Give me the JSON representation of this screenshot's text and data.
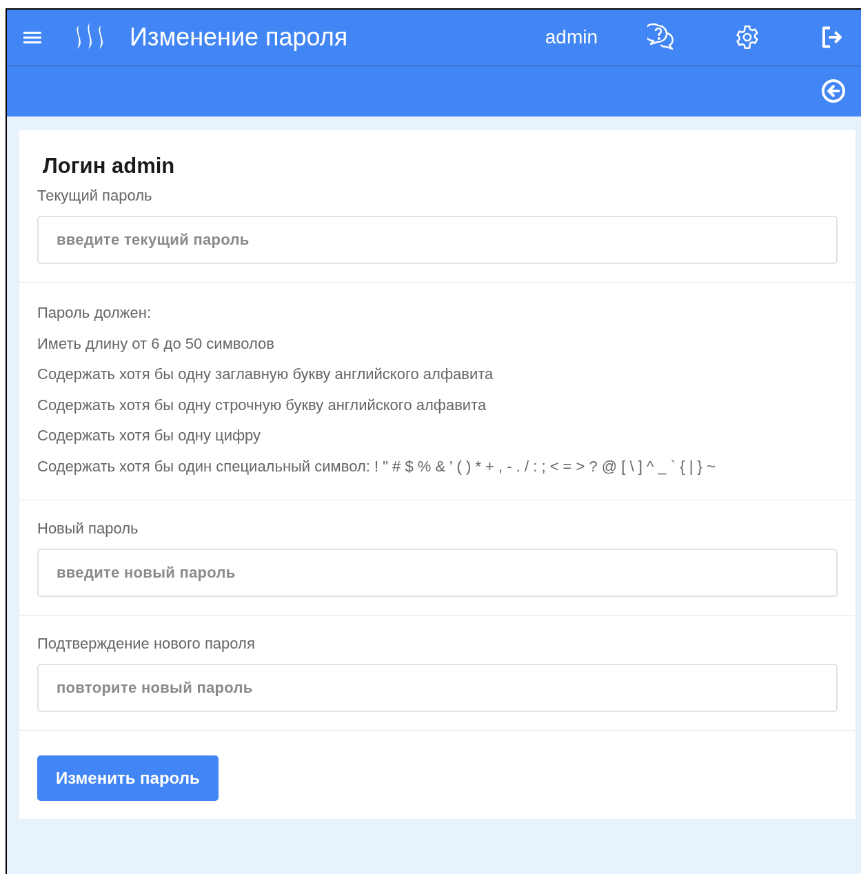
{
  "header": {
    "title": "Изменение пароля",
    "user": "admin"
  },
  "form": {
    "heading": "Логин admin",
    "current": {
      "label": "Текущий пароль",
      "placeholder": "введите текущий пароль"
    },
    "rules": {
      "title": "Пароль должен:",
      "items": [
        "Иметь длину от 6 до 50 символов",
        "Содержать хотя бы одну заглавную букву английского алфавита",
        "Содержать хотя бы одну строчную букву английского алфавита",
        "Содержать хотя бы одну цифру",
        "Содержать хотя бы один специальный символ: ! \" # $ % & ' ( ) * + , - . / : ; < = > ? @ [ \\ ] ^ _ ` { | } ~"
      ]
    },
    "new": {
      "label": "Новый пароль",
      "placeholder": "введите новый пароль"
    },
    "confirm": {
      "label": "Подтверждение нового пароля",
      "placeholder": "повторите новый пароль"
    },
    "submit": "Изменить пароль"
  }
}
